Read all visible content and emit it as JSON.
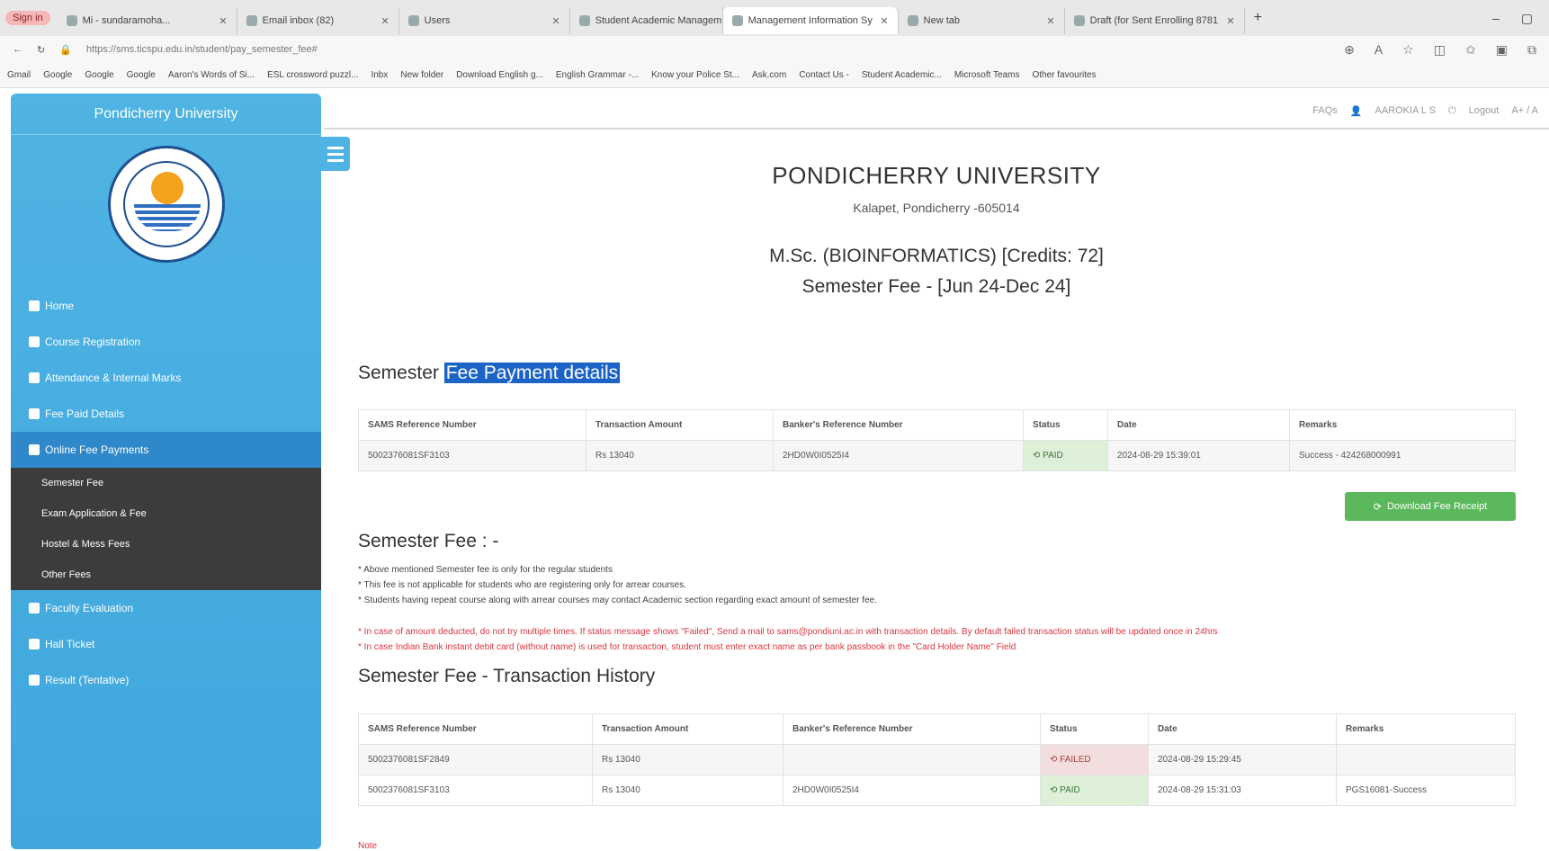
{
  "browser": {
    "signin": "Sign in",
    "tabs": [
      {
        "label": "Mi - sundaramoha..."
      },
      {
        "label": "Email inbox (82)"
      },
      {
        "label": "Users"
      },
      {
        "label": "Student Academic Managem"
      },
      {
        "label": "Management Information Sy"
      },
      {
        "label": "New tab"
      },
      {
        "label": "Draft (for Sent Enrolling 8781"
      }
    ],
    "url": "https://sms.ticspu.edu.in/student/pay_semester_fee#",
    "bookmarks": [
      "Gmail",
      "Google",
      "Google",
      "Google",
      "Aaron's Words of Si...",
      "ESL crossword puzzl...",
      "Inbx",
      "New folder",
      "Download English g...",
      "English Grammar -...",
      "Know your Police St...",
      "Ask.com",
      "Contact Us -",
      "Student Academic...",
      "Microsoft Teams",
      "Other favourites"
    ]
  },
  "sidebar": {
    "brand": "Pondicherry University",
    "nav": [
      {
        "label": "Home",
        "icon": "home-icon"
      },
      {
        "label": "Course Registration",
        "icon": "book-icon"
      },
      {
        "label": "Attendance & Internal Marks",
        "icon": "table-icon"
      },
      {
        "label": "Fee Paid Details",
        "icon": "rupee-icon"
      },
      {
        "label": "Online Fee Payments",
        "icon": "card-icon"
      }
    ],
    "submenu": [
      {
        "label": "Semester Fee"
      },
      {
        "label": "Exam Application & Fee"
      },
      {
        "label": "Hostel & Mess Fees"
      },
      {
        "label": "Other Fees"
      }
    ],
    "nav2": [
      {
        "label": "Faculty Evaluation",
        "icon": "globe-icon"
      },
      {
        "label": "Hall Ticket",
        "icon": "ticket-icon"
      },
      {
        "label": "Result (Tentative)",
        "icon": "chart-icon"
      }
    ]
  },
  "topnav": {
    "faqs": "FAQs",
    "user": "AAROKIA L S",
    "logout": "Logout",
    "font": "A+ / A"
  },
  "header": {
    "university": "PONDICHERRY UNIVERSITY",
    "address": "Kalapet, Pondicherry -605014",
    "programme": "M.Sc. (BIOINFORMATICS) [Credits: 72]",
    "semester": "Semester Fee - [Jun 24-Dec 24]"
  },
  "payment": {
    "title_prefix": "Semester ",
    "title_highlight": "Fee Payment details",
    "columns": [
      "SAMS Reference Number",
      "Transaction Amount",
      "Banker's Reference Number",
      "Status",
      "Date",
      "Remarks"
    ],
    "row": {
      "ref": "5002376081SF3103",
      "amount": "Rs 13040",
      "bank_ref": "2HD0W0I0525I4",
      "status": "PAID",
      "date": "2024-08-29 15:39:01",
      "remarks": "Success - 424268000991"
    }
  },
  "download_button": "Download Fee Receipt",
  "semester_fee": {
    "title": "Semester Fee : -",
    "notes": [
      "* Above mentioned Semester fee is only for the regular students",
      "* This fee is not applicable for students who are registering only for arrear courses.",
      "* Students having repeat course along with arrear courses may contact Academic section regarding exact amount of semester fee."
    ],
    "warnings": [
      "* In case of amount deducted, do not try multiple times. If status message shows \"Failed\", Send a mail to sams@pondiuni.ac.in with transaction details. By default failed transaction status will be updated once in 24hrs",
      "* In case Indian Bank instant debit card (without name) is used for transaction, student must enter exact name as per bank passbook in the \"Card Holder Name\" Field"
    ]
  },
  "history": {
    "title": "Semester Fee - Transaction History",
    "columns": [
      "SAMS Reference Number",
      "Transaction Amount",
      "Banker's Reference Number",
      "Status",
      "Date",
      "Remarks"
    ],
    "rows": [
      {
        "ref": "5002376081SF2849",
        "amount": "Rs 13040",
        "bank_ref": "",
        "status": "FAILED",
        "date": "2024-08-29 15:29:45",
        "remarks": ""
      },
      {
        "ref": "5002376081SF3103",
        "amount": "Rs 13040",
        "bank_ref": "2HD0W0I0525I4",
        "status": "PAID",
        "date": "2024-08-29 15:31:03",
        "remarks": "PGS16081-Success"
      }
    ]
  },
  "footer_note": "Note"
}
